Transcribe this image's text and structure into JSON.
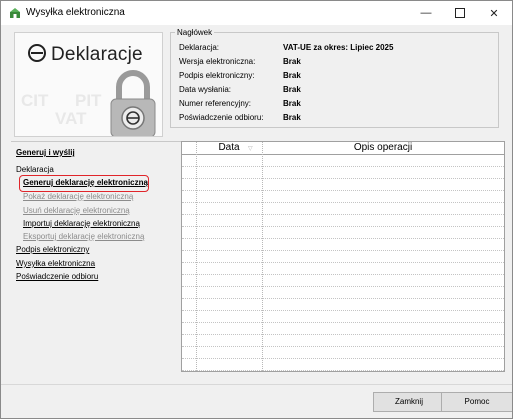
{
  "window": {
    "title": "Wysyłka elektroniczna",
    "minimize_glyph": "—",
    "close_glyph": "✕"
  },
  "logo": {
    "text": "Deklaracje",
    "icon": "edeklaracje-logo",
    "lock_icon": "padlock-icon",
    "watermark_words": [
      "CIT",
      "PIT",
      "VAT"
    ]
  },
  "header": {
    "legend": "Nagłówek",
    "rows": [
      {
        "label": "Deklaracja:",
        "value": "VAT-UE za okres: Lipiec 2025"
      },
      {
        "label": "Wersja elektroniczna:",
        "value": "Brak"
      },
      {
        "label": "Podpis elektroniczny:",
        "value": "Brak"
      },
      {
        "label": "Data wysłania:",
        "value": "Brak"
      },
      {
        "label": "Numer referencyjny:",
        "value": "Brak"
      },
      {
        "label": "Poświadczenie odbioru:",
        "value": "Brak"
      }
    ]
  },
  "nav": {
    "generuj_i_wyslij": "Generuj i wyślij",
    "deklaracja": "Deklaracja",
    "generuj": "Generuj deklarację elektroniczną",
    "pokaz": "Pokaż deklarację elektroniczną",
    "usun": "Usuń deklarację elektroniczną",
    "importuj": "Importuj deklarację elektroniczną",
    "eksportuj": "Eksportuj deklarację elektroniczną",
    "podpis": "Podpis elektroniczny",
    "wysylka": "Wysyłka elektroniczna",
    "poswiadczenie": "Poświadczenie odbioru"
  },
  "grid": {
    "columns": [
      "Data",
      "Opis operacji"
    ],
    "rows": []
  },
  "buttons": {
    "zamknij": "Zamknij",
    "pomoc": "Pomoc"
  },
  "colors": {
    "highlight": "#e0252a"
  }
}
